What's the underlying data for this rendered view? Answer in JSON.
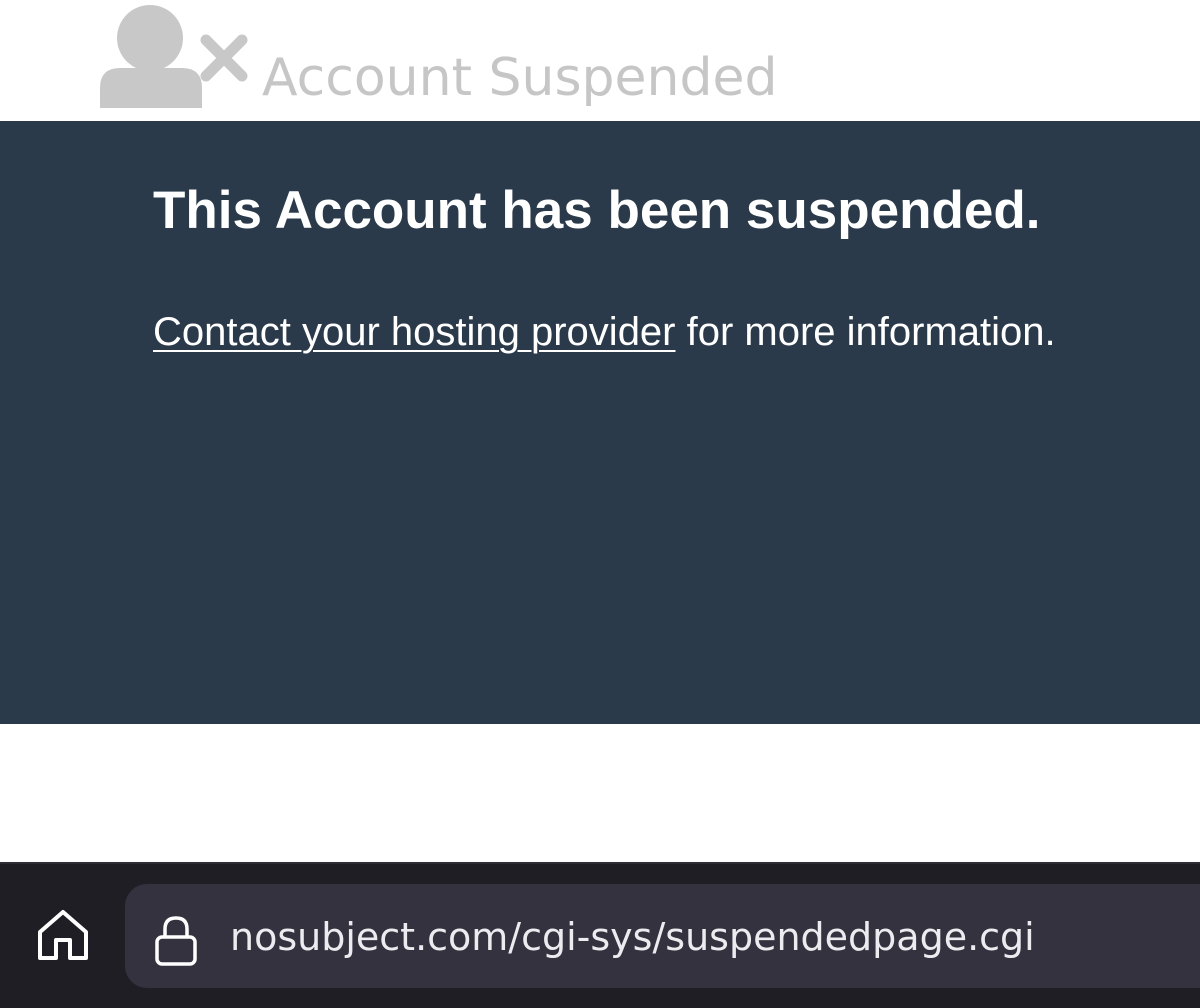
{
  "header": {
    "title": "Account Suspended",
    "icon": "user-remove-icon",
    "title_color": "#c6c6c6"
  },
  "panel": {
    "heading": "This Account has been suspended.",
    "link_text": "Contact your hosting provider",
    "message_rest": " for more information.",
    "background_color": "#2b3a4a"
  },
  "browser_bar": {
    "home_icon": "home-icon",
    "lock_icon": "lock-icon",
    "url": "nosubject.com/cgi-sys/suspendedpage.cgi",
    "background_color": "#1f1e25"
  }
}
